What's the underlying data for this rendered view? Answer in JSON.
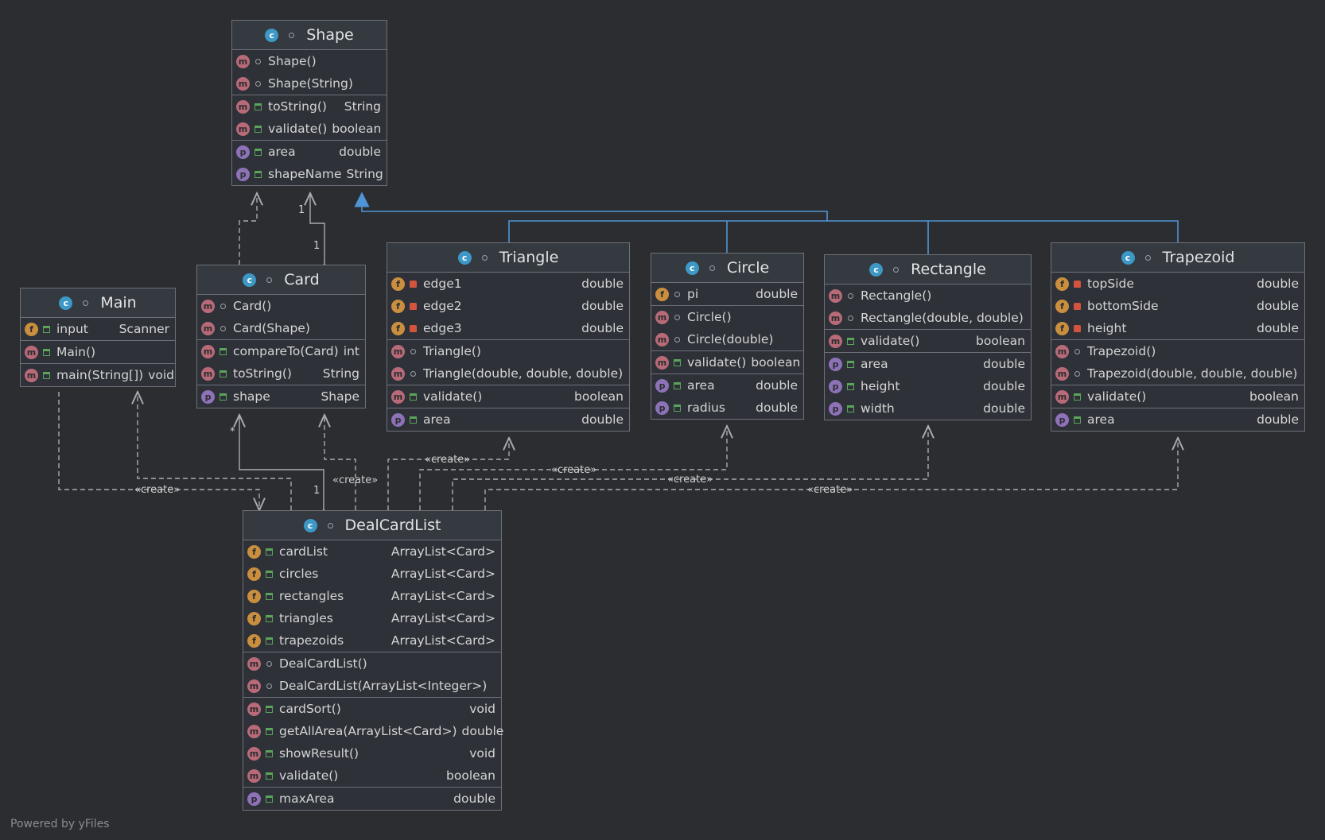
{
  "classes": {
    "shape": {
      "name": "Shape",
      "sections": [
        [
          {
            "kind": "m",
            "vis": "pkg",
            "name": "Shape()",
            "type": ""
          },
          {
            "kind": "m",
            "vis": "pkg",
            "name": "Shape(String)",
            "type": ""
          }
        ],
        [
          {
            "kind": "m",
            "vis": "pub",
            "name": "toString()",
            "type": "String"
          },
          {
            "kind": "m",
            "vis": "pub",
            "name": "validate()",
            "type": "boolean"
          }
        ],
        [
          {
            "kind": "p",
            "vis": "pub",
            "name": "area",
            "type": "double"
          },
          {
            "kind": "p",
            "vis": "pub",
            "name": "shapeName",
            "type": "String"
          }
        ]
      ]
    },
    "card": {
      "name": "Card",
      "sections": [
        [
          {
            "kind": "m",
            "vis": "pkg",
            "name": "Card()",
            "type": ""
          },
          {
            "kind": "m",
            "vis": "pkg",
            "name": "Card(Shape)",
            "type": ""
          }
        ],
        [
          {
            "kind": "m",
            "vis": "pub",
            "name": "compareTo(Card)",
            "type": "int"
          },
          {
            "kind": "m",
            "vis": "pub",
            "name": "toString()",
            "type": "String"
          }
        ],
        [
          {
            "kind": "p",
            "vis": "pub",
            "name": "shape",
            "type": "Shape"
          }
        ]
      ]
    },
    "main": {
      "name": "Main",
      "sections": [
        [
          {
            "kind": "f",
            "vis": "pub",
            "name": "input",
            "type": "Scanner"
          }
        ],
        [
          {
            "kind": "m",
            "vis": "pub",
            "name": "Main()",
            "type": ""
          }
        ],
        [
          {
            "kind": "m",
            "vis": "pub",
            "name": "main(String[])",
            "type": "void"
          }
        ]
      ]
    },
    "triangle": {
      "name": "Triangle",
      "sections": [
        [
          {
            "kind": "f",
            "vis": "pri",
            "name": "edge1",
            "type": "double"
          },
          {
            "kind": "f",
            "vis": "pri",
            "name": "edge2",
            "type": "double"
          },
          {
            "kind": "f",
            "vis": "pri",
            "name": "edge3",
            "type": "double"
          }
        ],
        [
          {
            "kind": "m",
            "vis": "pkg",
            "name": "Triangle()",
            "type": ""
          },
          {
            "kind": "m",
            "vis": "pkg",
            "name": "Triangle(double, double, double)",
            "type": ""
          }
        ],
        [
          {
            "kind": "m",
            "vis": "pub",
            "name": "validate()",
            "type": "boolean"
          }
        ],
        [
          {
            "kind": "p",
            "vis": "pub",
            "name": "area",
            "type": "double"
          }
        ]
      ]
    },
    "circle": {
      "name": "Circle",
      "sections": [
        [
          {
            "kind": "f",
            "vis": "pkg",
            "name": "pi",
            "type": "double"
          }
        ],
        [
          {
            "kind": "m",
            "vis": "pkg",
            "name": "Circle()",
            "type": ""
          },
          {
            "kind": "m",
            "vis": "pkg",
            "name": "Circle(double)",
            "type": ""
          }
        ],
        [
          {
            "kind": "m",
            "vis": "pub",
            "name": "validate()",
            "type": "boolean"
          }
        ],
        [
          {
            "kind": "p",
            "vis": "pub",
            "name": "area",
            "type": "double"
          },
          {
            "kind": "p",
            "vis": "pub",
            "name": "radius",
            "type": "double"
          }
        ]
      ]
    },
    "rectangle": {
      "name": "Rectangle",
      "sections": [
        [
          {
            "kind": "m",
            "vis": "pkg",
            "name": "Rectangle()",
            "type": ""
          },
          {
            "kind": "m",
            "vis": "pkg",
            "name": "Rectangle(double, double)",
            "type": ""
          }
        ],
        [
          {
            "kind": "m",
            "vis": "pub",
            "name": "validate()",
            "type": "boolean"
          }
        ],
        [
          {
            "kind": "p",
            "vis": "pub",
            "name": "area",
            "type": "double"
          },
          {
            "kind": "p",
            "vis": "pub",
            "name": "height",
            "type": "double"
          },
          {
            "kind": "p",
            "vis": "pub",
            "name": "width",
            "type": "double"
          }
        ]
      ]
    },
    "trapezoid": {
      "name": "Trapezoid",
      "sections": [
        [
          {
            "kind": "f",
            "vis": "pri",
            "name": "topSide",
            "type": "double"
          },
          {
            "kind": "f",
            "vis": "pri",
            "name": "bottomSide",
            "type": "double"
          },
          {
            "kind": "f",
            "vis": "pri",
            "name": "height",
            "type": "double"
          }
        ],
        [
          {
            "kind": "m",
            "vis": "pkg",
            "name": "Trapezoid()",
            "type": ""
          },
          {
            "kind": "m",
            "vis": "pkg",
            "name": "Trapezoid(double, double, double)",
            "type": ""
          }
        ],
        [
          {
            "kind": "m",
            "vis": "pub",
            "name": "validate()",
            "type": "boolean"
          }
        ],
        [
          {
            "kind": "p",
            "vis": "pub",
            "name": "area",
            "type": "double"
          }
        ]
      ]
    },
    "dealcardlist": {
      "name": "DealCardList",
      "sections": [
        [
          {
            "kind": "f",
            "vis": "pub",
            "name": "cardList",
            "type": "ArrayList<Card>"
          },
          {
            "kind": "f",
            "vis": "pub",
            "name": "circles",
            "type": "ArrayList<Card>"
          },
          {
            "kind": "f",
            "vis": "pub",
            "name": "rectangles",
            "type": "ArrayList<Card>"
          },
          {
            "kind": "f",
            "vis": "pub",
            "name": "triangles",
            "type": "ArrayList<Card>"
          },
          {
            "kind": "f",
            "vis": "pub",
            "name": "trapezoids",
            "type": "ArrayList<Card>"
          }
        ],
        [
          {
            "kind": "m",
            "vis": "pkg",
            "name": "DealCardList()",
            "type": ""
          },
          {
            "kind": "m",
            "vis": "pkg",
            "name": "DealCardList(ArrayList<Integer>)",
            "type": ""
          }
        ],
        [
          {
            "kind": "m",
            "vis": "pub",
            "name": "cardSort()",
            "type": "void"
          },
          {
            "kind": "m",
            "vis": "pub",
            "name": "getAllArea(ArrayList<Card>)",
            "type": "double"
          },
          {
            "kind": "m",
            "vis": "pub",
            "name": "showResult()",
            "type": "void"
          },
          {
            "kind": "m",
            "vis": "pub",
            "name": "validate()",
            "type": "boolean"
          }
        ],
        [
          {
            "kind": "p",
            "vis": "pub",
            "name": "maxArea",
            "type": "double"
          }
        ]
      ]
    }
  },
  "kind_letters": {
    "m": "m",
    "f": "f",
    "p": "p",
    "c": "c"
  },
  "edge_labels": {
    "create": "«create»",
    "mult_one": "1",
    "mult_many": "*"
  },
  "colors": {
    "inheritance": "#4f95d6",
    "dependency": "#a9abae",
    "method": "#b86a78",
    "field": "#c98f3e",
    "property": "#8d72b8",
    "class": "#3d98c6"
  },
  "footer": "Powered by yFiles"
}
